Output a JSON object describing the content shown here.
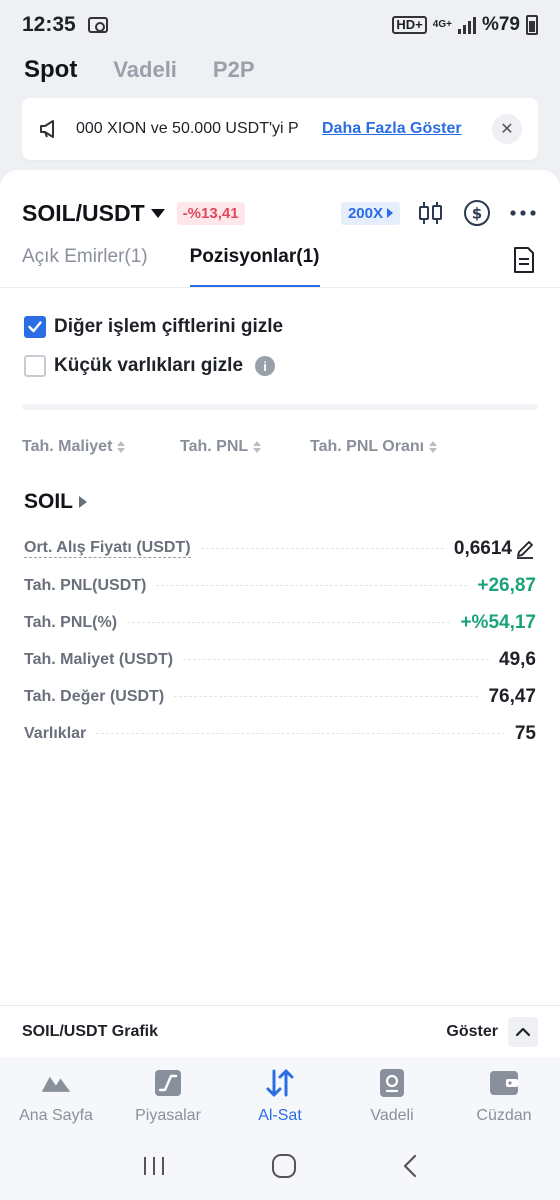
{
  "status": {
    "time": "12:35",
    "hd": "HD+",
    "network": "4G+",
    "battery": "%79"
  },
  "top_tabs": [
    "Spot",
    "Vadeli",
    "P2P"
  ],
  "banner": {
    "text": "000 XION ve 50.000 USDT'yi P",
    "more": "Daha Fazla Göster"
  },
  "pair": {
    "name": "SOIL/USDT",
    "change": "-%13,41",
    "leverage": "200X"
  },
  "sub_tabs": [
    "Açık Emirler(1)",
    "Pozisyonlar(1)"
  ],
  "filters": {
    "hide_pairs": "Diğer işlem çiftlerini gizle",
    "hide_small": "Küçük varlıkları gizle",
    "info": "i"
  },
  "sort": [
    "Tah. Maliyet",
    "Tah. PNL",
    "Tah. PNL Oranı"
  ],
  "asset": {
    "name": "SOIL",
    "rows": [
      {
        "label": "Ort. Alış Fiyatı (USDT)",
        "value": "0,6614"
      },
      {
        "label": "Tah. PNL(USDT)",
        "value": "+26,87"
      },
      {
        "label": "Tah. PNL(%)",
        "value": "+%54,17"
      },
      {
        "label": "Tah. Maliyet (USDT)",
        "value": "49,6"
      },
      {
        "label": "Tah. Değer (USDT)",
        "value": "76,47"
      },
      {
        "label": "Varlıklar",
        "value": "75"
      }
    ]
  },
  "chart_bar": {
    "label": "SOIL/USDT Grafik",
    "show": "Göster"
  },
  "nav": [
    "Ana Sayfa",
    "Piyasalar",
    "Al-Sat",
    "Vadeli",
    "Cüzdan"
  ],
  "colors": {
    "accent": "#2b6de5",
    "positive": "#1aa37a",
    "negative": "#e04a5e"
  }
}
